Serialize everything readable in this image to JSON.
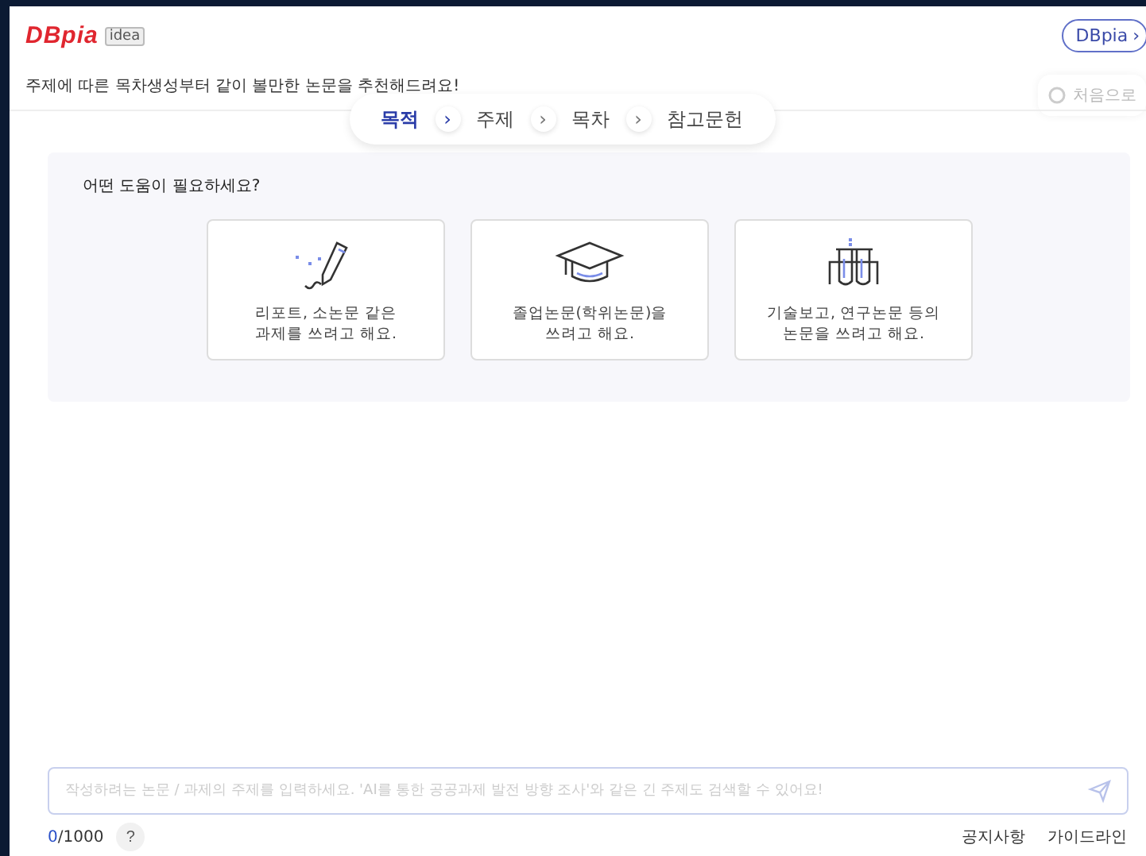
{
  "header": {
    "logo": "DBpia",
    "logo_badge": "idea",
    "link_button": "DBpia",
    "link_caret": "›",
    "subtitle": "주제에 따른 목차생성부터 같이 볼만한 논문을 추천해드려요!",
    "reset_button": "처음으로"
  },
  "steps": [
    {
      "label": "목적",
      "selected": true
    },
    {
      "label": "주제",
      "selected": false
    },
    {
      "label": "목차",
      "selected": false
    },
    {
      "label": "참고문헌",
      "selected": false
    }
  ],
  "step_separator": "›",
  "question": "어떤 도움이 필요하세요?",
  "options": [
    {
      "kind": "pen",
      "lines": [
        "리포트, 소논문 같은",
        "과제를 쓰려고 해요."
      ]
    },
    {
      "kind": "cap",
      "lines": [
        "졸업논문(학위논문)을",
        "쓰려고 해요."
      ]
    },
    {
      "kind": "tubes",
      "lines": [
        "기술보고, 연구논문 등의",
        "논문을 쓰려고 해요."
      ]
    }
  ],
  "input": {
    "placeholder": "작성하려는 논문 / 과제의 주제를 입력하세요. 'AI를 통한 공공과제 발전 방향 조사'와 같은 긴 주제도 검색할 수 있어요!"
  },
  "counter": {
    "count": "0",
    "limit": "/1000",
    "help": "?"
  },
  "footer_links": [
    "공지사항",
    "가이드라인"
  ]
}
